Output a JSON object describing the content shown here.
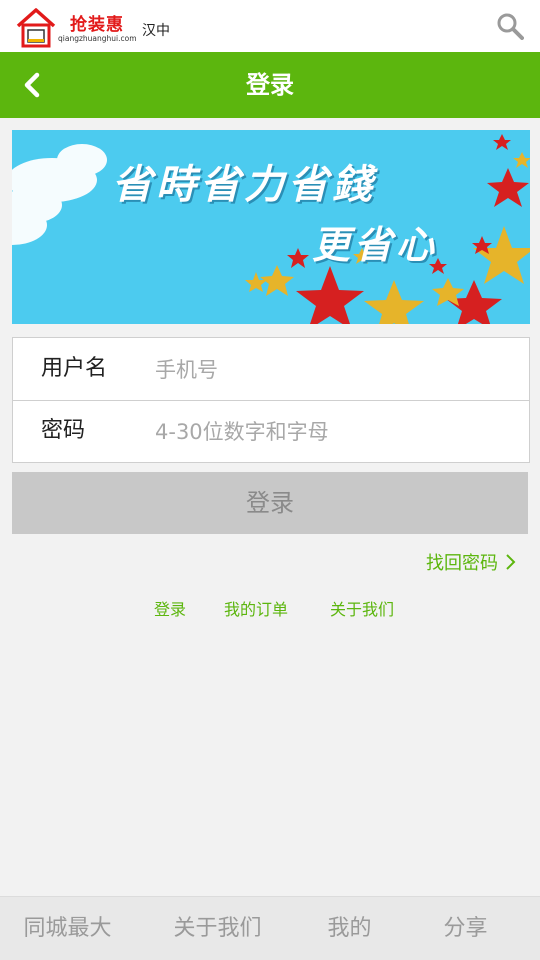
{
  "topbar": {
    "logo_text": "抢装惠",
    "logo_url": "qiangzhuanghui.com",
    "city": "汉中",
    "search_icon": "search-icon"
  },
  "header": {
    "title": "登录",
    "back_icon": "chevron-left-icon"
  },
  "banner": {
    "line1": "省時省力省錢",
    "line2": "更省心"
  },
  "form": {
    "username_label": "用户名",
    "username_placeholder": "手机号",
    "password_label": "密码",
    "password_placeholder": "4-30位数字和字母"
  },
  "login_button": "登录",
  "forgot_password": "找回密码",
  "links": [
    "登录",
    "我的订单",
    "关于我们"
  ],
  "bottom_tabs": [
    "同城最大",
    "关于我们",
    "我的",
    "分享"
  ],
  "colors": {
    "accent": "#5cb60e",
    "banner_bg": "#4ccbef",
    "button_disabled": "#c8c8c8",
    "brand_red": "#e21a1a"
  }
}
